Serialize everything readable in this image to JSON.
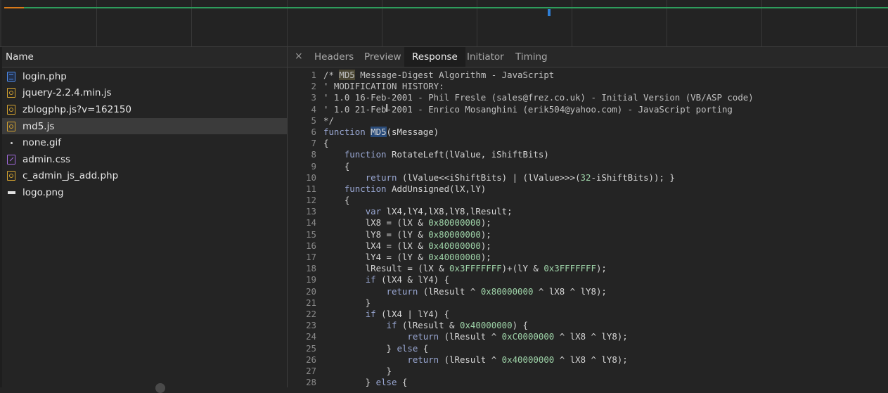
{
  "files": [
    {
      "name": "login.php",
      "icon": "document-icon",
      "type": "doc"
    },
    {
      "name": "jquery-2.2.4.min.js",
      "icon": "script-icon",
      "type": "js"
    },
    {
      "name": "zblogphp.js?v=162150",
      "icon": "script-icon",
      "type": "js"
    },
    {
      "name": "md5.js",
      "icon": "script-icon",
      "type": "js",
      "selected": true
    },
    {
      "name": "none.gif",
      "icon": "image-icon",
      "type": "gif"
    },
    {
      "name": "admin.css",
      "icon": "stylesheet-icon",
      "type": "css"
    },
    {
      "name": "c_admin_js_add.php",
      "icon": "script-icon",
      "type": "js"
    },
    {
      "name": "logo.png",
      "icon": "image-icon",
      "type": "png"
    }
  ],
  "list_header": "Name",
  "tabs": {
    "close": "×",
    "headers": "Headers",
    "preview": "Preview",
    "response": "Response",
    "initiator": "Initiator",
    "timing": "Timing",
    "active": "Response"
  },
  "code": [
    "/* MD5 Message-Digest Algorithm - JavaScript",
    "' MODIFICATION HISTORY:",
    "' 1.0 16-Feb-2001 - Phil Fresle (sales@frez.co.uk) - Initial Version (VB/ASP code)",
    "' 1.0 21-Feb-2001 - Enrico Mosanghini (erik504@yahoo.com) - JavaScript porting",
    "*/",
    "function MD5(sMessage)",
    "{",
    "    function RotateLeft(lValue, iShiftBits)",
    "    {",
    "        return (lValue<<iShiftBits) | (lValue>>>(32-iShiftBits)); }",
    "    function AddUnsigned(lX,lY)",
    "    {",
    "        var lX4,lY4,lX8,lY8,lResult;",
    "        lX8 = (lX & 0x80000000);",
    "        lY8 = (lY & 0x80000000);",
    "        lX4 = (lX & 0x40000000);",
    "        lY4 = (lY & 0x40000000);",
    "        lResult = (lX & 0x3FFFFFFF)+(lY & 0x3FFFFFFF);",
    "        if (lX4 & lY4) {",
    "            return (lResult ^ 0x80000000 ^ lX8 ^ lY8);",
    "        }",
    "        if (lX4 | lY4) {",
    "            if (lResult & 0x40000000) {",
    "                return (lResult ^ 0xC0000000 ^ lX8 ^ lY8);",
    "            } else {",
    "                return (lResult ^ 0x40000000 ^ lX8 ^ lY8);",
    "            }",
    "        } else {"
  ],
  "colors": {
    "background": "#242424",
    "timeline_green": "#2e9c5c",
    "timeline_orange": "#d97a1a",
    "timeline_blue": "#2f7fd6",
    "keyword": "#9aa8d4",
    "number": "#9ed3a8",
    "search_highlight": "#4a4632",
    "selection": "#2a4c7a"
  }
}
